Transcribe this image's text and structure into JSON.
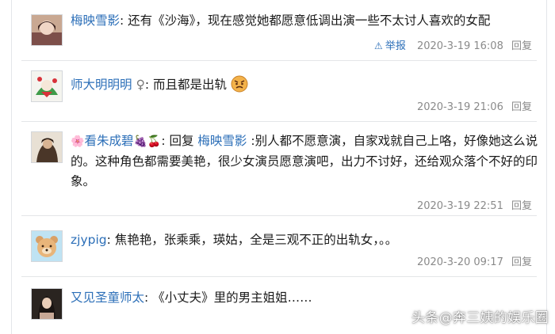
{
  "comments": [
    {
      "user": "梅映雪影",
      "sep": ": ",
      "text": "还有《沙海》，现在感觉她都愿意低调出演一些不太讨人喜欢的女配",
      "report_label": "举报",
      "time": "2020-3-19 16:08",
      "reply_label": "回复"
    },
    {
      "user": "师大明明明",
      "gender_symbol": "♀",
      "sep": ": ",
      "text": "而且都是出轨",
      "time": "2020-3-19 21:06",
      "reply_label": "回复"
    },
    {
      "user_prefix_emoji": "🌸",
      "user": "看朱成碧",
      "user_suffix_emoji": "🍇🍒",
      "sep": ": ",
      "reply_prefix": "回复 ",
      "reply_to": "梅映雪影",
      "text": " :别人都不愿意演，自家戏就自己上咯，好像她这么说的。这种角色都需要美艳，很少女演员愿意演吧，出力不讨好，还给观众落个不好的印象。",
      "time": "2020-3-19 22:51",
      "reply_label": "回复"
    },
    {
      "user": "zjypig",
      "sep": ": ",
      "text": "焦艳艳，张乘乘，瑛姑，全是三观不正的出轨女，。。",
      "time": "2020-3-20 09:17",
      "reply_label": "回复"
    },
    {
      "user": "又见圣童师太",
      "sep": ": ",
      "text": "《小丈夫》里的男主姐姐……"
    }
  ],
  "watermark": "头条@奔三姨的娱乐圈",
  "colors": {
    "username": "#2c6fb8",
    "meta": "#8a8a8a",
    "divider": "#e4e6e8"
  }
}
